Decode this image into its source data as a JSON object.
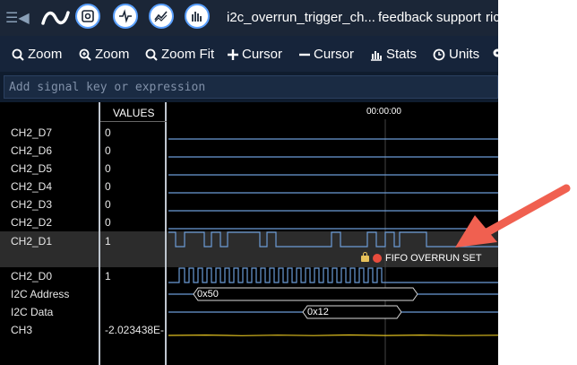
{
  "nav": {
    "title": "i2c_overrun_trigger_ch...",
    "links": [
      "feedback",
      "support",
      "ric"
    ]
  },
  "toolbar": {
    "zoom_in": "Zoom",
    "zoom_out": "Zoom",
    "zoom_fit": "Zoom Fit",
    "add_cursor": "Cursor",
    "remove_cursor": "Cursor",
    "stats": "Stats",
    "units": "Units"
  },
  "search": {
    "placeholder": "Add signal key or expression"
  },
  "columns": {
    "values_header": "VALUES",
    "time_label": "00:00:00"
  },
  "signals": [
    {
      "name": "CH2_D7",
      "value": "0"
    },
    {
      "name": "CH2_D6",
      "value": "0"
    },
    {
      "name": "CH2_D5",
      "value": "0"
    },
    {
      "name": "CH2_D4",
      "value": "0"
    },
    {
      "name": "CH2_D3",
      "value": "0"
    },
    {
      "name": "CH2_D2",
      "value": "0"
    },
    {
      "name": "CH2_D1",
      "value": "1"
    },
    {
      "name": "CH2_D0",
      "value": "1"
    },
    {
      "name": "I2C Address",
      "value": ""
    },
    {
      "name": "I2C Data",
      "value": ""
    },
    {
      "name": "CH3",
      "value": "-2.023438E-"
    }
  ],
  "bus": {
    "address": "0x50",
    "data": "0x12"
  },
  "annotation": {
    "text": "FIFO OVERRUN SET"
  },
  "colors": {
    "wave": "#6b9bd6",
    "analog": "#e0c020",
    "arrow": "#f06050",
    "accent": "#5aa0ff"
  }
}
